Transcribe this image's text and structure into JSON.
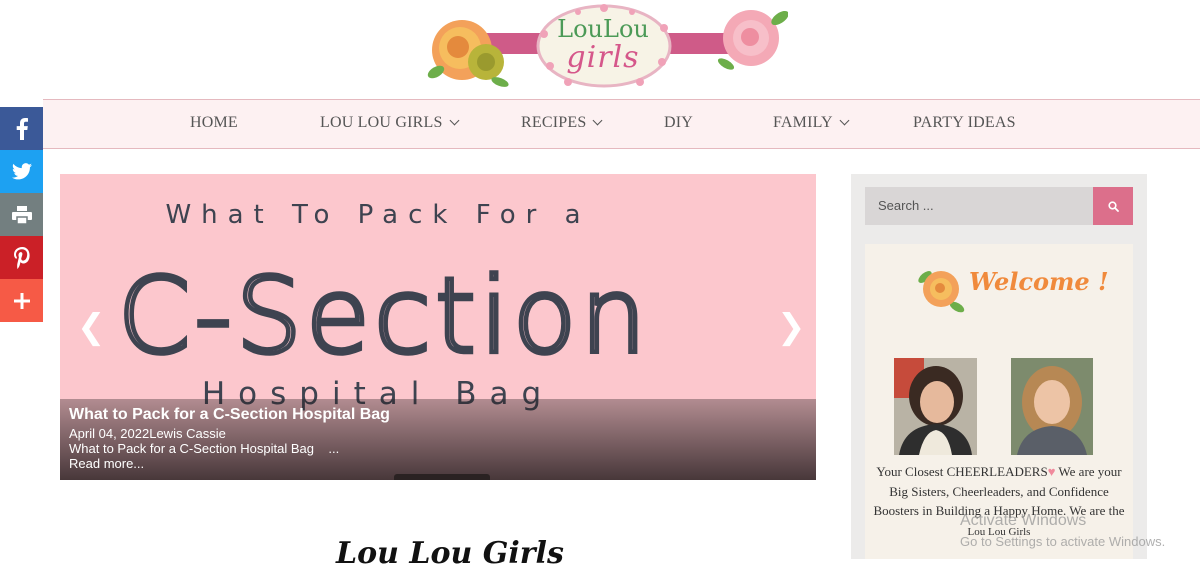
{
  "site": {
    "logo_line1": "LouLou",
    "logo_line2": "girls"
  },
  "nav": {
    "items": [
      {
        "label": "HOME",
        "has_dropdown": false
      },
      {
        "label": "LOU LOU GIRLS",
        "has_dropdown": true
      },
      {
        "label": "RECIPES",
        "has_dropdown": true
      },
      {
        "label": "DIY",
        "has_dropdown": false
      },
      {
        "label": "FAMILY",
        "has_dropdown": true
      },
      {
        "label": "PARTY IDEAS",
        "has_dropdown": false
      }
    ]
  },
  "share": {
    "buttons": [
      {
        "name": "facebook",
        "color": "#3b5998"
      },
      {
        "name": "twitter",
        "color": "#1da1f2"
      },
      {
        "name": "print",
        "color": "#737f80"
      },
      {
        "name": "pinterest",
        "color": "#cb2027"
      },
      {
        "name": "more",
        "color": "#f65a46"
      }
    ]
  },
  "slider": {
    "image_line1": "What To Pack For a",
    "image_line2": "C-Section",
    "image_line3": "Hospital Bag",
    "prev_arrow": "❮",
    "next_arrow": "❯",
    "caption": {
      "title": "What to Pack for a C-Section Hospital Bag",
      "meta": "April 04, 2022Lewis Cassie",
      "excerpt": "What to Pack for a C-Section Hospital Bag    ...",
      "read_more": "Read more..."
    }
  },
  "section": {
    "heading": "Lou Lou Girls"
  },
  "sidebar": {
    "search_placeholder": "Search ...",
    "welcome_title": "Welcome !",
    "about_text_1": "Your Closest CHEERLEADERS",
    "about_text_2": " We are your Big Sisters, Cheerleaders, and Confidence Boosters in Building a Happy Home. We are the",
    "about_signature": "Lou Lou Girls"
  },
  "os": {
    "watermark_line1": "Activate Windows",
    "watermark_line2": "Go to Settings to activate Windows."
  },
  "colors": {
    "brand_pink": "#dc6f8b",
    "nav_bg": "#fdf1f2",
    "slide_bg": "#fcc7cd",
    "welcome_orange": "#f08a3c"
  }
}
